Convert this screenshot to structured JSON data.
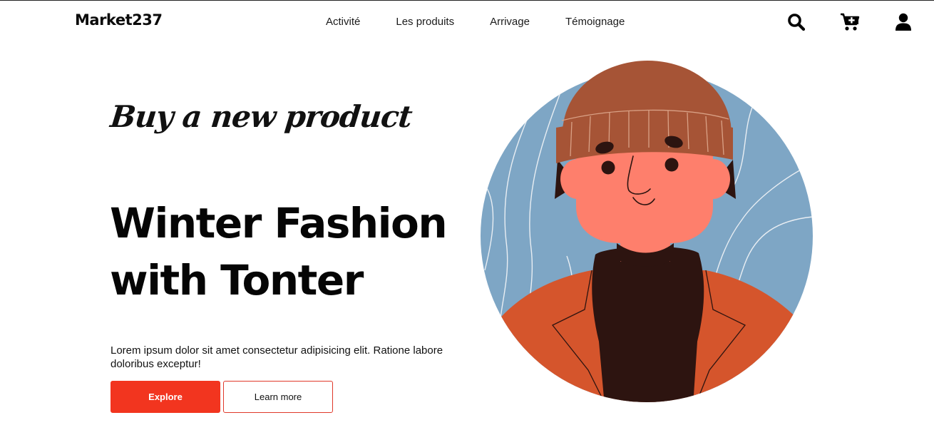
{
  "brand": {
    "name": "Market237"
  },
  "nav": {
    "links": [
      {
        "label": "Activité"
      },
      {
        "label": "Les produits"
      },
      {
        "label": "Arrivage"
      },
      {
        "label": "Témoignage"
      }
    ],
    "icons": [
      "search-icon",
      "cart-plus-icon",
      "user-icon"
    ]
  },
  "hero": {
    "tagline": "Buy a new product",
    "headline_line1": "Winter Fashion",
    "headline_line2": "with Tonter",
    "description": "Lorem ipsum dolor sit amet consectetur adipisicing elit. Ratione labore doloribus exceptur!",
    "primary_button": "Explore",
    "secondary_button": "Learn more"
  },
  "colors": {
    "accent": "#f2351f",
    "circle_bg": "#7ea6c5",
    "beanie": "#a65436",
    "skin": "#fe7f6c",
    "jacket": "#d5552c",
    "sweater": "#2d1410"
  }
}
